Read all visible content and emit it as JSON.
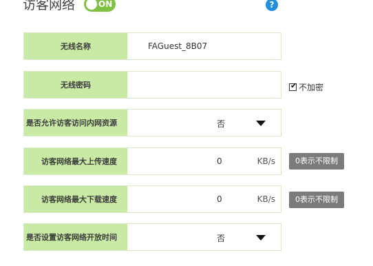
{
  "header": {
    "title": "访客网络",
    "toggle_label": "ON",
    "help_symbol": "?"
  },
  "rows": [
    {
      "label": "无线名称",
      "value": "FAGuest_8B07"
    },
    {
      "label": "无线密码",
      "value": ""
    },
    {
      "label": "是否允许访客访问内网资源",
      "value": "否"
    },
    {
      "label": "访客网络最大上传速度",
      "value": "0",
      "unit": "KB/s",
      "hint": "0表示不限制"
    },
    {
      "label": "访客网络最大下载速度",
      "value": "0",
      "unit": "KB/s",
      "hint": "0表示不限制"
    },
    {
      "label": "是否设置访客网络开放时间",
      "value": "否"
    }
  ],
  "no_password_checkbox": {
    "label": "不加密",
    "checked": true
  }
}
